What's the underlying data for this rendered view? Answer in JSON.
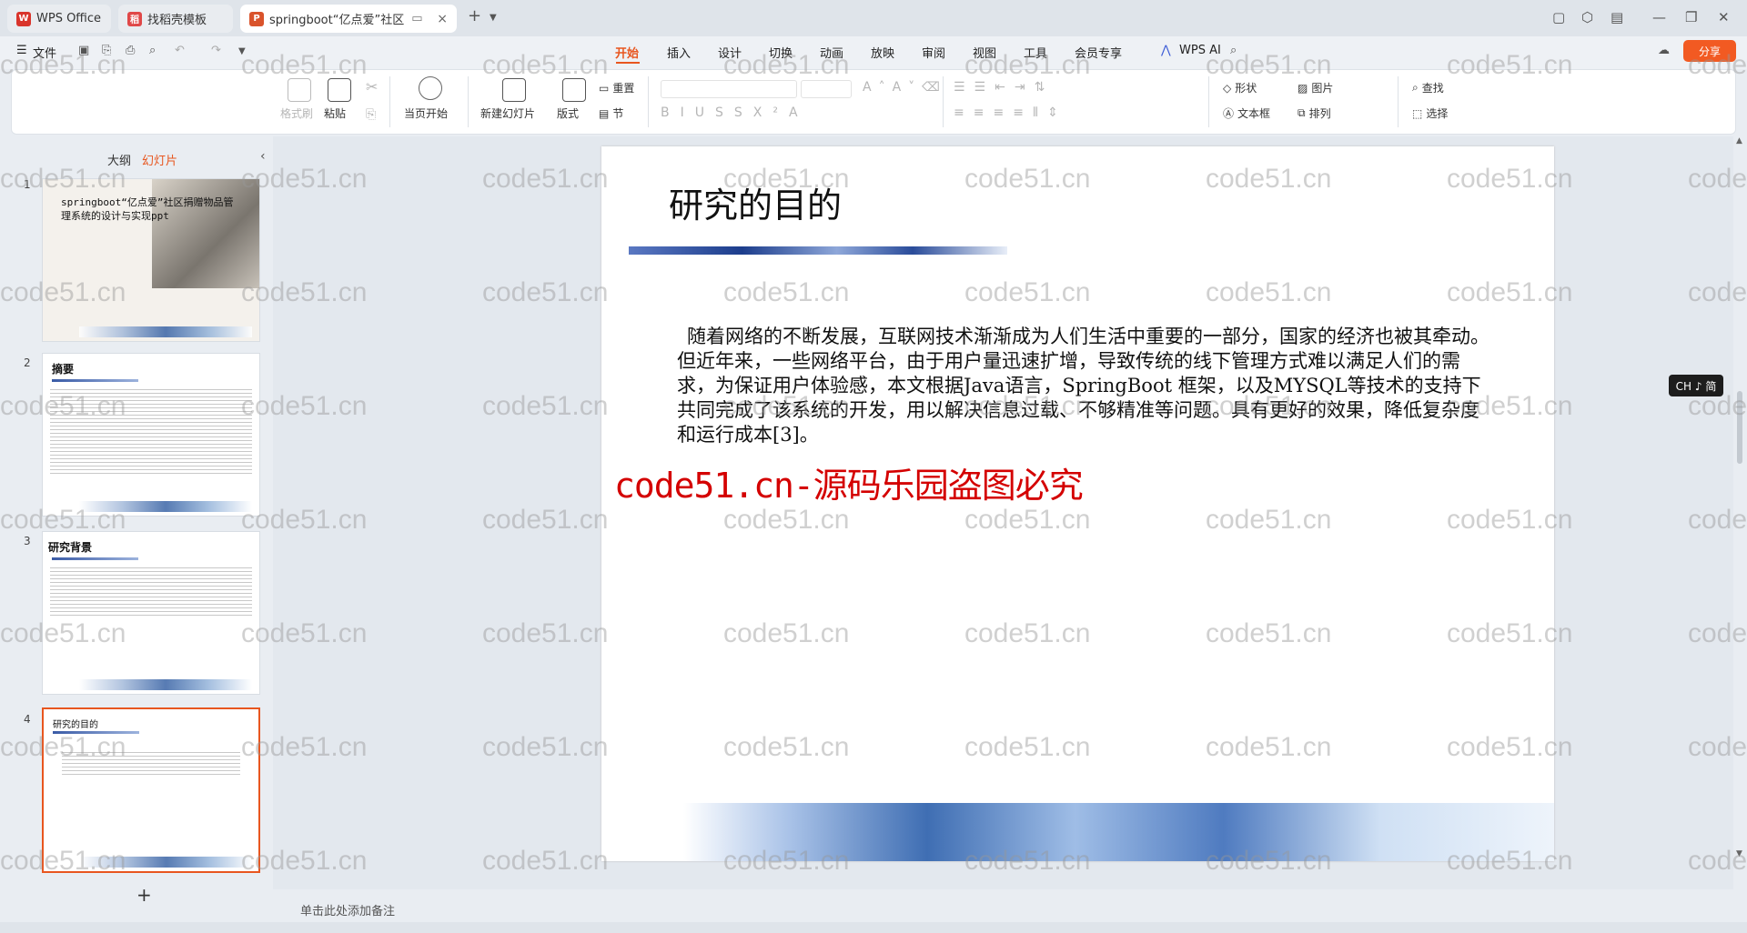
{
  "titlebar": {
    "tabs": [
      {
        "label": "WPS Office",
        "icon": "wps-logo-icon"
      },
      {
        "label": "找稻壳模板",
        "icon": "docer-icon"
      },
      {
        "label": "springboot“亿点爱”社区",
        "icon": "ppt-icon"
      }
    ],
    "new_tab": "+"
  },
  "menu": {
    "file": "文件",
    "items": [
      "开始",
      "插入",
      "设计",
      "切换",
      "动画",
      "放映",
      "审阅",
      "视图",
      "工具",
      "会员专享"
    ],
    "ai": "WPS AI",
    "share": "分享"
  },
  "ribbon": {
    "format_painter": "格式刷",
    "paste": "粘贴",
    "from_current": "当页开始",
    "new_slide": "新建幻灯片",
    "layout": "版式",
    "reset": "重置",
    "section": "节",
    "shape": "形状",
    "picture": "图片",
    "textbox": "文本框",
    "arrange": "排列",
    "find": "查找",
    "select": "选择"
  },
  "panel": {
    "outline_tab": "大纲",
    "slides_tab": "幻灯片",
    "add_button": "+",
    "thumbs": [
      {
        "num": "1",
        "title": "springboot“亿点爱”社区捐赠物品管理系统的设计与实现ppt"
      },
      {
        "num": "2",
        "title": "摘要"
      },
      {
        "num": "3",
        "title": "研究背景"
      },
      {
        "num": "4",
        "title": "研究的目的"
      }
    ]
  },
  "slide": {
    "title": "研究的目的",
    "body": "随着网络的不断发展，互联网技术渐渐成为人们生活中重要的一部分，国家的经济也被其牵动。但近年来，一些网络平台，由于用户量迅速扩增，导致传统的线下管理方式难以满足人们的需求，为保证用户体验感，本文根据Java语言，SpringBoot 框架，以及MYSQL等技术的支持下共同完成了该系统的开发，用以解决信息过载、不够精准等问题。具有更好的效果，降低复杂度和运行成本[3]。",
    "watermark": "code51.cn-源码乐园盗图必究"
  },
  "notes_placeholder": "单击此处添加备注",
  "ime": "CH ♪ 简",
  "watermark_text": "code51.cn",
  "colors": {
    "accent": "#e8561f",
    "watermark_red": "#d40000"
  }
}
